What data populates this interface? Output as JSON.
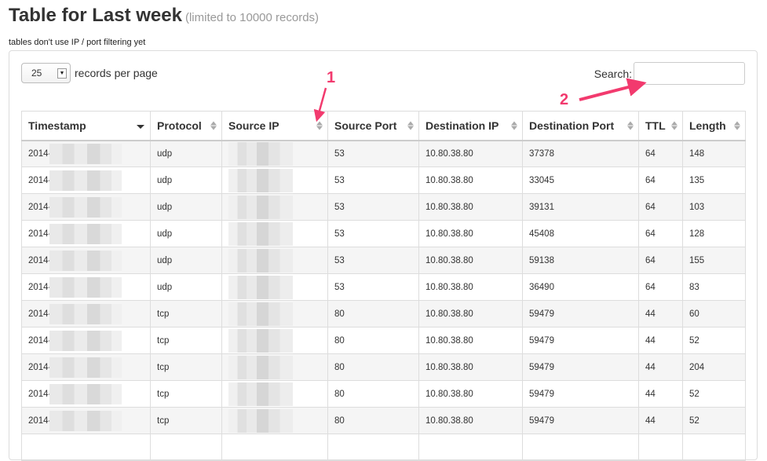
{
  "header": {
    "title": "Table for Last week",
    "subtitle": "(limited to 10000 records)",
    "note": "tables don't use IP / port filtering yet"
  },
  "length_control": {
    "selected": "25",
    "label": "records per page"
  },
  "search": {
    "label": "Search:",
    "value": ""
  },
  "table": {
    "columns": [
      "Timestamp",
      "Protocol",
      "Source IP",
      "Source Port",
      "Destination IP",
      "Destination Port",
      "TTL",
      "Length"
    ],
    "sorted_column": "Timestamp",
    "sort_direction": "descending",
    "rows": [
      {
        "timestamp": "2014-",
        "protocol": "udp",
        "source_port": "53",
        "destination_ip": "10.80.38.80",
        "destination_port": "37378",
        "ttl": "64",
        "length": "148"
      },
      {
        "timestamp": "2014-",
        "protocol": "udp",
        "source_port": "53",
        "destination_ip": "10.80.38.80",
        "destination_port": "33045",
        "ttl": "64",
        "length": "135"
      },
      {
        "timestamp": "2014-",
        "protocol": "udp",
        "source_port": "53",
        "destination_ip": "10.80.38.80",
        "destination_port": "39131",
        "ttl": "64",
        "length": "103"
      },
      {
        "timestamp": "2014-",
        "protocol": "udp",
        "source_port": "53",
        "destination_ip": "10.80.38.80",
        "destination_port": "45408",
        "ttl": "64",
        "length": "128"
      },
      {
        "timestamp": "2014-",
        "protocol": "udp",
        "source_port": "53",
        "destination_ip": "10.80.38.80",
        "destination_port": "59138",
        "ttl": "64",
        "length": "155"
      },
      {
        "timestamp": "2014-",
        "protocol": "udp",
        "source_port": "53",
        "destination_ip": "10.80.38.80",
        "destination_port": "36490",
        "ttl": "64",
        "length": "83"
      },
      {
        "timestamp": "2014-",
        "protocol": "tcp",
        "source_port": "80",
        "destination_ip": "10.80.38.80",
        "destination_port": "59479",
        "ttl": "44",
        "length": "60"
      },
      {
        "timestamp": "2014-",
        "protocol": "tcp",
        "source_port": "80",
        "destination_ip": "10.80.38.80",
        "destination_port": "59479",
        "ttl": "44",
        "length": "52"
      },
      {
        "timestamp": "2014-",
        "protocol": "tcp",
        "source_port": "80",
        "destination_ip": "10.80.38.80",
        "destination_port": "59479",
        "ttl": "44",
        "length": "204"
      },
      {
        "timestamp": "2014-",
        "protocol": "tcp",
        "source_port": "80",
        "destination_ip": "10.80.38.80",
        "destination_port": "59479",
        "ttl": "44",
        "length": "52"
      },
      {
        "timestamp": "2014-",
        "protocol": "tcp",
        "source_port": "80",
        "destination_ip": "10.80.38.80",
        "destination_port": "59479",
        "ttl": "44",
        "length": "52"
      },
      {
        "timestamp": "",
        "protocol": "",
        "source_port": "",
        "destination_ip": "",
        "destination_port": "",
        "ttl": "",
        "length": ""
      }
    ]
  },
  "annotations": {
    "marker_1": "1",
    "marker_2": "2",
    "color": "#f23a6e"
  }
}
